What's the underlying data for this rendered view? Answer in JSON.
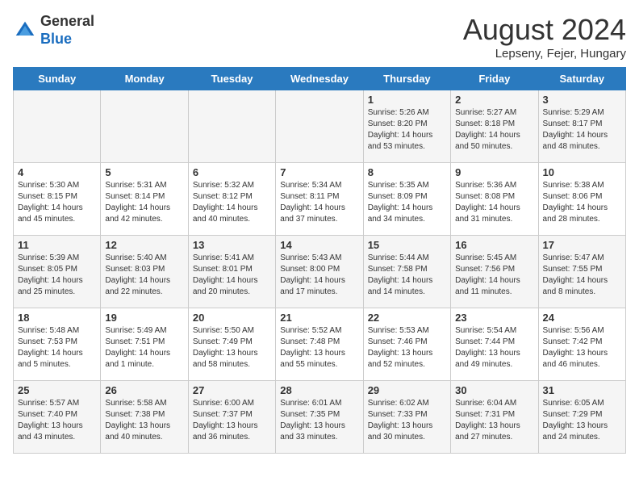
{
  "header": {
    "logo_line1": "General",
    "logo_line2": "Blue",
    "title": "August 2024",
    "subtitle": "Lepseny, Fejer, Hungary"
  },
  "weekdays": [
    "Sunday",
    "Monday",
    "Tuesday",
    "Wednesday",
    "Thursday",
    "Friday",
    "Saturday"
  ],
  "weeks": [
    [
      {
        "day": "",
        "info": ""
      },
      {
        "day": "",
        "info": ""
      },
      {
        "day": "",
        "info": ""
      },
      {
        "day": "",
        "info": ""
      },
      {
        "day": "1",
        "info": "Sunrise: 5:26 AM\nSunset: 8:20 PM\nDaylight: 14 hours and 53 minutes."
      },
      {
        "day": "2",
        "info": "Sunrise: 5:27 AM\nSunset: 8:18 PM\nDaylight: 14 hours and 50 minutes."
      },
      {
        "day": "3",
        "info": "Sunrise: 5:29 AM\nSunset: 8:17 PM\nDaylight: 14 hours and 48 minutes."
      }
    ],
    [
      {
        "day": "4",
        "info": "Sunrise: 5:30 AM\nSunset: 8:15 PM\nDaylight: 14 hours and 45 minutes."
      },
      {
        "day": "5",
        "info": "Sunrise: 5:31 AM\nSunset: 8:14 PM\nDaylight: 14 hours and 42 minutes."
      },
      {
        "day": "6",
        "info": "Sunrise: 5:32 AM\nSunset: 8:12 PM\nDaylight: 14 hours and 40 minutes."
      },
      {
        "day": "7",
        "info": "Sunrise: 5:34 AM\nSunset: 8:11 PM\nDaylight: 14 hours and 37 minutes."
      },
      {
        "day": "8",
        "info": "Sunrise: 5:35 AM\nSunset: 8:09 PM\nDaylight: 14 hours and 34 minutes."
      },
      {
        "day": "9",
        "info": "Sunrise: 5:36 AM\nSunset: 8:08 PM\nDaylight: 14 hours and 31 minutes."
      },
      {
        "day": "10",
        "info": "Sunrise: 5:38 AM\nSunset: 8:06 PM\nDaylight: 14 hours and 28 minutes."
      }
    ],
    [
      {
        "day": "11",
        "info": "Sunrise: 5:39 AM\nSunset: 8:05 PM\nDaylight: 14 hours and 25 minutes."
      },
      {
        "day": "12",
        "info": "Sunrise: 5:40 AM\nSunset: 8:03 PM\nDaylight: 14 hours and 22 minutes."
      },
      {
        "day": "13",
        "info": "Sunrise: 5:41 AM\nSunset: 8:01 PM\nDaylight: 14 hours and 20 minutes."
      },
      {
        "day": "14",
        "info": "Sunrise: 5:43 AM\nSunset: 8:00 PM\nDaylight: 14 hours and 17 minutes."
      },
      {
        "day": "15",
        "info": "Sunrise: 5:44 AM\nSunset: 7:58 PM\nDaylight: 14 hours and 14 minutes."
      },
      {
        "day": "16",
        "info": "Sunrise: 5:45 AM\nSunset: 7:56 PM\nDaylight: 14 hours and 11 minutes."
      },
      {
        "day": "17",
        "info": "Sunrise: 5:47 AM\nSunset: 7:55 PM\nDaylight: 14 hours and 8 minutes."
      }
    ],
    [
      {
        "day": "18",
        "info": "Sunrise: 5:48 AM\nSunset: 7:53 PM\nDaylight: 14 hours and 5 minutes."
      },
      {
        "day": "19",
        "info": "Sunrise: 5:49 AM\nSunset: 7:51 PM\nDaylight: 14 hours and 1 minute."
      },
      {
        "day": "20",
        "info": "Sunrise: 5:50 AM\nSunset: 7:49 PM\nDaylight: 13 hours and 58 minutes."
      },
      {
        "day": "21",
        "info": "Sunrise: 5:52 AM\nSunset: 7:48 PM\nDaylight: 13 hours and 55 minutes."
      },
      {
        "day": "22",
        "info": "Sunrise: 5:53 AM\nSunset: 7:46 PM\nDaylight: 13 hours and 52 minutes."
      },
      {
        "day": "23",
        "info": "Sunrise: 5:54 AM\nSunset: 7:44 PM\nDaylight: 13 hours and 49 minutes."
      },
      {
        "day": "24",
        "info": "Sunrise: 5:56 AM\nSunset: 7:42 PM\nDaylight: 13 hours and 46 minutes."
      }
    ],
    [
      {
        "day": "25",
        "info": "Sunrise: 5:57 AM\nSunset: 7:40 PM\nDaylight: 13 hours and 43 minutes."
      },
      {
        "day": "26",
        "info": "Sunrise: 5:58 AM\nSunset: 7:38 PM\nDaylight: 13 hours and 40 minutes."
      },
      {
        "day": "27",
        "info": "Sunrise: 6:00 AM\nSunset: 7:37 PM\nDaylight: 13 hours and 36 minutes."
      },
      {
        "day": "28",
        "info": "Sunrise: 6:01 AM\nSunset: 7:35 PM\nDaylight: 13 hours and 33 minutes."
      },
      {
        "day": "29",
        "info": "Sunrise: 6:02 AM\nSunset: 7:33 PM\nDaylight: 13 hours and 30 minutes."
      },
      {
        "day": "30",
        "info": "Sunrise: 6:04 AM\nSunset: 7:31 PM\nDaylight: 13 hours and 27 minutes."
      },
      {
        "day": "31",
        "info": "Sunrise: 6:05 AM\nSunset: 7:29 PM\nDaylight: 13 hours and 24 minutes."
      }
    ]
  ]
}
